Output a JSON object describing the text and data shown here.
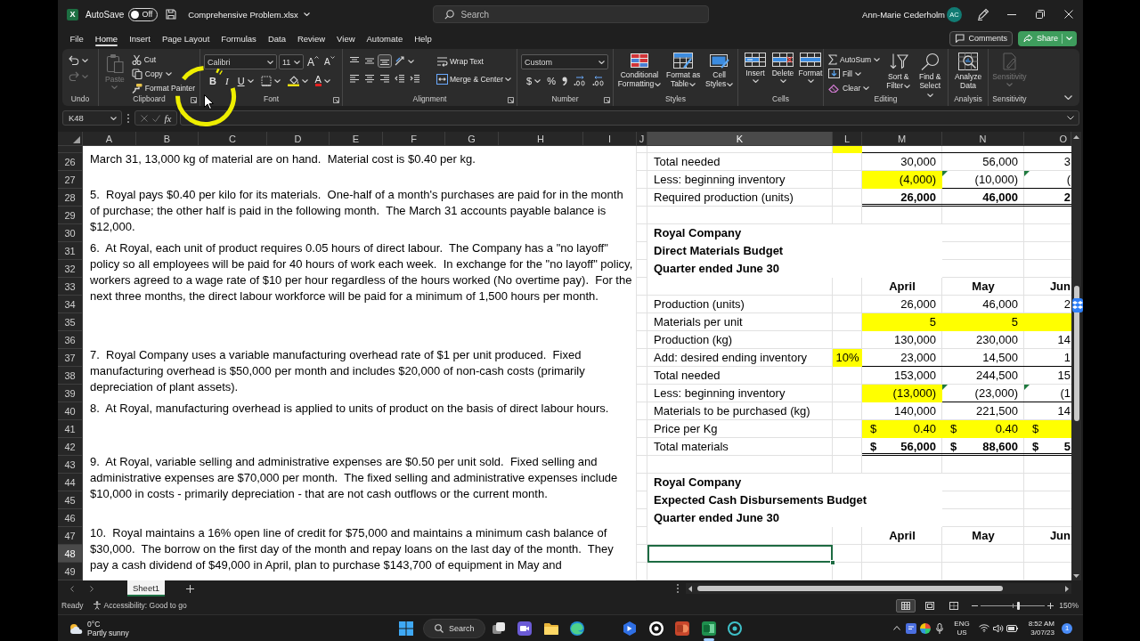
{
  "window": {
    "logo": "X",
    "autosave_label": "AutoSave",
    "autosave": {
      "on": false,
      "label": "Off"
    },
    "file_name": "Comprehensive Problem.xlsx",
    "search": {
      "placeholder": "Search"
    },
    "user_name": "Ann-Marie Cederholm",
    "user_initials": "AC"
  },
  "ribbon_tabs": [
    {
      "label": "File",
      "selected": false
    },
    {
      "label": "Home",
      "selected": true
    },
    {
      "label": "Insert",
      "selected": false
    },
    {
      "label": "Page Layout",
      "selected": false
    },
    {
      "label": "Formulas",
      "selected": false
    },
    {
      "label": "Data",
      "selected": false
    },
    {
      "label": "Review",
      "selected": false
    },
    {
      "label": "View",
      "selected": false
    },
    {
      "label": "Automate",
      "selected": false
    },
    {
      "label": "Help",
      "selected": false
    }
  ],
  "comments_button": "Comments",
  "share_button": "Share",
  "ribbon": {
    "undo": {
      "label": "Undo",
      "redo": {
        "disabled": true
      }
    },
    "clipboard": {
      "label": "Clipboard",
      "paste": {
        "label": "Paste",
        "disabled": true
      },
      "cut": "Cut",
      "copy": "Copy",
      "format_painter": "Format Painter"
    },
    "font": {
      "label": "Font",
      "font_name": "Calibri",
      "font_size": "11",
      "grow_font": "A",
      "shrink_font": "A",
      "bold": "B",
      "italic": "I",
      "underline": "U",
      "font_color": "A"
    },
    "alignment": {
      "label": "Alignment",
      "vertical_align": [
        {
          "selected": false
        },
        {
          "selected": false
        },
        {
          "selected": true
        }
      ],
      "wrap_text": "Wrap Text",
      "merge_center": "Merge & Center"
    },
    "number": {
      "label": "Number",
      "format": "Custom",
      "currency": "$",
      "percent": "%"
    },
    "styles": {
      "label": "Styles",
      "conditional_formatting": "Conditional Formatting",
      "format_as_table": "Format as Table",
      "cell_styles": "Cell Styles"
    },
    "cells": {
      "label": "Cells",
      "insert": "Insert",
      "delete": "Delete",
      "format": "Format"
    },
    "editing": {
      "label": "Editing",
      "autosum": "AutoSum",
      "fill": "Fill",
      "clear": "Clear",
      "sort_filter": "Sort & Filter",
      "find_select": "Find & Select"
    },
    "analysis": {
      "label": "Analysis",
      "analyze_data": "Analyze Data"
    },
    "sensitivity": {
      "label": "Sensitivity",
      "button": {
        "label": "Sensitivity",
        "disabled": true
      }
    }
  },
  "formula_bar": {
    "name_box": "K48",
    "cancel": {
      "disabled": true
    },
    "enter": {
      "disabled": true
    },
    "function": "fx"
  },
  "sheet": {
    "columns": [
      {
        "label": "A",
        "selected": false
      },
      {
        "label": "B",
        "selected": false
      },
      {
        "label": "C",
        "selected": false
      },
      {
        "label": "D",
        "selected": false
      },
      {
        "label": "E",
        "selected": false
      },
      {
        "label": "F",
        "selected": false
      },
      {
        "label": "G",
        "selected": false
      },
      {
        "label": "H",
        "selected": false
      },
      {
        "label": "I",
        "selected": false
      },
      {
        "label": "J",
        "selected": false
      },
      {
        "label": "K",
        "selected": true
      },
      {
        "label": "L",
        "selected": false
      },
      {
        "label": "M",
        "selected": false
      },
      {
        "label": "N",
        "selected": false
      },
      {
        "label": "O",
        "selected": false
      }
    ],
    "rows": [
      {
        "kind": "clipped",
        "selected": false,
        "rule_below": true,
        "rate": {
          "highlighted": true
        }
      },
      {
        "number": "26",
        "kind": "line",
        "selected": false,
        "rule_below": false,
        "note": "March 31, 13,000 kg of material are on hand.  Material cost is $0.40 per kg.",
        "label": "Total needed",
        "values": [
          {
            "text": "30,000",
            "highlighted": false,
            "flagged": false
          },
          {
            "text": "56,000",
            "highlighted": false,
            "flagged": false
          },
          {
            "text": "3",
            "highlighted": false,
            "flagged": false
          }
        ]
      },
      {
        "number": "27",
        "kind": "line",
        "selected": false,
        "rule_below": true,
        "label": "Less: beginning inventory",
        "values": [
          {
            "text": "(4,000)",
            "highlighted": true,
            "flagged": false
          },
          {
            "text": "(10,000)",
            "highlighted": false,
            "flagged": true
          },
          {
            "text": "(",
            "highlighted": false,
            "flagged": true
          }
        ]
      },
      {
        "number": "28",
        "kind": "total",
        "selected": false,
        "rule_below": true,
        "note": "5.  Royal pays $0.40 per kilo for its materials.  One-half of a month's purchases are paid for in the month of purchase; the other half is paid in the following month.  The March 31 accounts payable balance is $12,000.",
        "label": "Required production (units)",
        "values": [
          {
            "text": "26,000",
            "highlighted": false,
            "flagged": false
          },
          {
            "text": "46,000",
            "highlighted": false,
            "flagged": false
          },
          {
            "text": "2",
            "highlighted": false,
            "flagged": false
          }
        ]
      },
      {
        "number": "29",
        "kind": "empty",
        "selected": false,
        "rule_below": false
      },
      {
        "number": "30",
        "kind": "title",
        "selected": false,
        "rule_below": false,
        "label": "Royal Company"
      },
      {
        "number": "31",
        "kind": "title",
        "selected": false,
        "rule_below": false,
        "note": "6.  At Royal, each unit of product requires 0.05 hours of direct labour.  The Company has a \"no layoff\" policy so all employees will be paid for 40 hours of work each week.  In exchange for the \"no layoff\" policy, workers agreed to a wage rate of $10 per hour regardless of the hours worked (No overtime pay).  For the next three months, the direct labour workforce will be paid for a minimum of 1,500 hours per month.",
        "label": "Direct Materials Budget"
      },
      {
        "number": "32",
        "kind": "title",
        "selected": false,
        "rule_below": false,
        "label": "Quarter ended June 30"
      },
      {
        "number": "33",
        "kind": "header",
        "selected": false,
        "rule_below": false,
        "values": [
          {
            "text": "April",
            "highlighted": false,
            "flagged": false
          },
          {
            "text": "May",
            "highlighted": false,
            "flagged": false
          },
          {
            "text": "Jun",
            "highlighted": false,
            "flagged": false
          }
        ]
      },
      {
        "number": "34",
        "kind": "line",
        "selected": false,
        "rule_below": false,
        "label": "Production (units)",
        "values": [
          {
            "text": "26,000",
            "highlighted": false,
            "flagged": false
          },
          {
            "text": "46,000",
            "highlighted": false,
            "flagged": false
          },
          {
            "text": "2",
            "highlighted": false,
            "flagged": false
          }
        ]
      },
      {
        "number": "35",
        "kind": "line",
        "selected": false,
        "rule_below": false,
        "label": "Materials per unit",
        "values": [
          {
            "text": "5",
            "highlighted": true,
            "flagged": false
          },
          {
            "text": "5",
            "highlighted": true,
            "flagged": false
          },
          {
            "highlighted": true,
            "flagged": false
          }
        ]
      },
      {
        "number": "36",
        "kind": "line",
        "selected": false,
        "rule_below": false,
        "label": "Production (kg)",
        "values": [
          {
            "text": "130,000",
            "highlighted": false,
            "flagged": false
          },
          {
            "text": "230,000",
            "highlighted": false,
            "flagged": false
          },
          {
            "text": "14",
            "highlighted": false,
            "flagged": false
          }
        ]
      },
      {
        "number": "37",
        "kind": "line",
        "selected": false,
        "rule_below": true,
        "note": "7.  Royal Company uses a variable manufacturing overhead rate of $1 per unit produced.  Fixed manufacturing overhead is $50,000 per month and includes $20,000 of non-cash costs (primarily depreciation of plant assets).",
        "label": "Add: desired ending inventory",
        "rate": {
          "text": "10%",
          "highlighted": true
        },
        "values": [
          {
            "text": "23,000",
            "highlighted": false,
            "flagged": false
          },
          {
            "text": "14,500",
            "highlighted": false,
            "flagged": false
          },
          {
            "text": "1",
            "highlighted": false,
            "flagged": false
          }
        ]
      },
      {
        "number": "38",
        "kind": "line",
        "selected": false,
        "rule_below": false,
        "label": "Total needed",
        "values": [
          {
            "text": "153,000",
            "highlighted": false,
            "flagged": false
          },
          {
            "text": "244,500",
            "highlighted": false,
            "flagged": false
          },
          {
            "text": "15",
            "highlighted": false,
            "flagged": false
          }
        ]
      },
      {
        "number": "39",
        "kind": "line",
        "selected": false,
        "rule_below": true,
        "label": "Less: beginning inventory",
        "values": [
          {
            "text": "(13,000)",
            "highlighted": true,
            "flagged": false
          },
          {
            "text": "(23,000)",
            "highlighted": false,
            "flagged": true
          },
          {
            "text": "(1",
            "highlighted": false,
            "flagged": true
          }
        ]
      },
      {
        "number": "40",
        "kind": "line",
        "selected": false,
        "rule_below": false,
        "note": "8.  At Royal, manufacturing overhead is applied to units of product on the basis of direct labour hours.",
        "label": "Materials to be purchased (kg)",
        "values": [
          {
            "text": "140,000",
            "highlighted": false,
            "flagged": false
          },
          {
            "text": "221,500",
            "highlighted": false,
            "flagged": false
          },
          {
            "text": "14",
            "highlighted": false,
            "flagged": false
          }
        ]
      },
      {
        "number": "41",
        "kind": "line",
        "selected": false,
        "rule_below": false,
        "label": "Price per Kg",
        "values": [
          {
            "currency": "$",
            "text": "0.40",
            "highlighted": true,
            "flagged": false
          },
          {
            "currency": "$",
            "text": "0.40",
            "highlighted": true,
            "flagged": false
          },
          {
            "currency": "$",
            "highlighted": true,
            "flagged": false
          }
        ]
      },
      {
        "number": "42",
        "kind": "total",
        "selected": false,
        "rule_below": true,
        "label": "Total materials",
        "values": [
          {
            "currency": "$",
            "text": "56,000",
            "highlighted": false,
            "flagged": false
          },
          {
            "currency": "$",
            "text": "88,600",
            "highlighted": false,
            "flagged": false
          },
          {
            "currency": "$",
            "text": "5",
            "highlighted": false,
            "flagged": false
          }
        ]
      },
      {
        "number": "43",
        "kind": "empty",
        "selected": false,
        "rule_below": false,
        "note": "9.  At Royal, variable selling and administrative expenses are $0.50 per unit sold.  Fixed selling and administrative expenses are $70,000 per month.  The fixed selling and administrative expenses include $10,000 in costs - primarily depreciation - that are not cash outflows or the current month."
      },
      {
        "number": "44",
        "kind": "title",
        "selected": false,
        "rule_below": false,
        "label": "Royal Company"
      },
      {
        "number": "45",
        "kind": "title",
        "selected": false,
        "rule_below": false,
        "label": "Expected Cash Disbursements Budget"
      },
      {
        "number": "46",
        "kind": "title",
        "selected": false,
        "rule_below": false,
        "label": "Quarter ended June 30"
      },
      {
        "number": "47",
        "kind": "header",
        "selected": false,
        "rule_below": false,
        "note": "10.  Royal maintains a 16% open line of credit for $75,000 and maintains a minimum cash balance of $30,000.  The borrow on the first day of the month and repay loans on the last day of the month.  They pay a cash dividend of $49,000 in April, plan to purchase $143,700 of equipment in May and",
        "values": [
          {
            "text": "April",
            "highlighted": false,
            "flagged": false
          },
          {
            "text": "May",
            "highlighted": false,
            "flagged": false
          },
          {
            "text": "Jun",
            "highlighted": false,
            "flagged": false
          }
        ]
      },
      {
        "number": "48",
        "kind": "empty",
        "selected": true,
        "rule_below": false
      },
      {
        "number": "49",
        "kind": "empty",
        "selected": false,
        "rule_below": false
      }
    ]
  },
  "sheet_tabs": [
    {
      "label": "Sheet1",
      "selected": true
    }
  ],
  "status_bar": {
    "mode": "Ready",
    "accessibility": "Accessibility: Good to go",
    "views": [
      {
        "selected": true
      },
      {
        "selected": false
      },
      {
        "selected": false
      }
    ],
    "zoom": {
      "level": 0.58,
      "reading": "150%"
    }
  },
  "taskbar": {
    "temperature": "0°C",
    "weather": "Partly sunny",
    "search": "Search",
    "apps": [
      {
        "active": false
      },
      {
        "active": false
      },
      {
        "active": false
      },
      {
        "active": false
      },
      {
        "active": false
      },
      {
        "active": false
      },
      {
        "active": false
      },
      {
        "active": true
      },
      {
        "active": false
      }
    ],
    "language": "ENG",
    "region": "US",
    "time": "8:52 AM",
    "date": "3/07/23",
    "notifications": "1"
  }
}
